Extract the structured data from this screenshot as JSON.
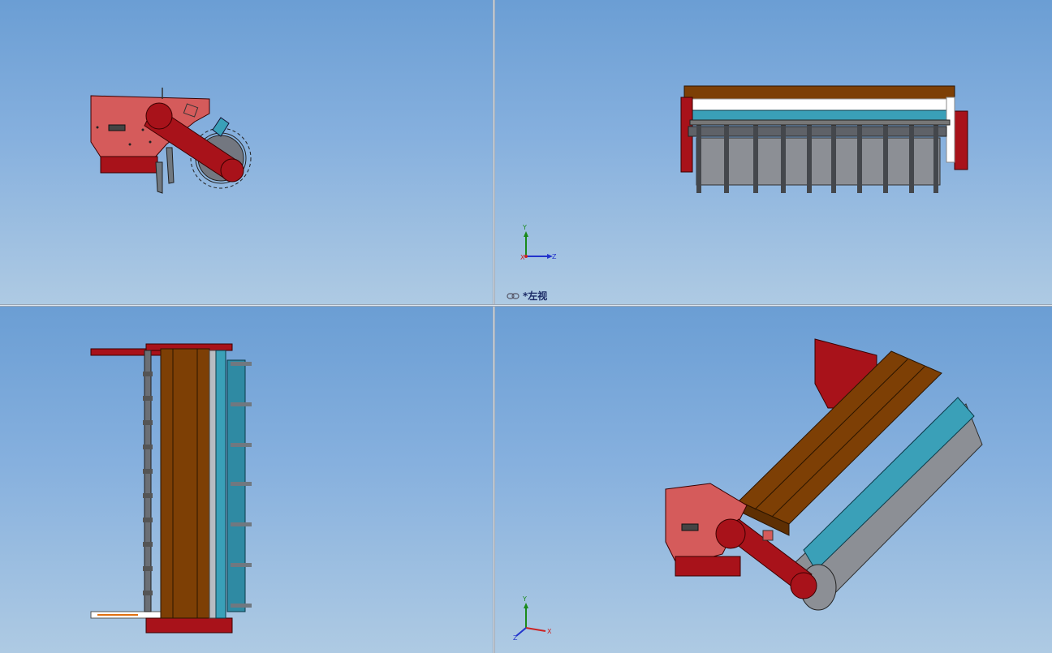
{
  "viewports": {
    "front": {
      "name": "front-view"
    },
    "left": {
      "name": "left-view",
      "label": "*左视",
      "triad": {
        "y": "Y",
        "x": "X",
        "z": "Z"
      }
    },
    "top": {
      "name": "top-view"
    },
    "isometric": {
      "name": "isometric-view",
      "triad": {
        "y": "Y",
        "z": "Z",
        "x": "X"
      }
    }
  },
  "colors": {
    "frame_red": "#a8121a",
    "plate_pink": "#d55b5b",
    "hopper_brown": "#7d3f05",
    "rail_teal": "#3aa0b8",
    "roller_gray": "#8c8f95",
    "background_top": "#6b9ed4",
    "background_bottom": "#aecae3"
  },
  "icons": {
    "view_link": "link-icon",
    "triad": "coordinate-triad-icon"
  }
}
